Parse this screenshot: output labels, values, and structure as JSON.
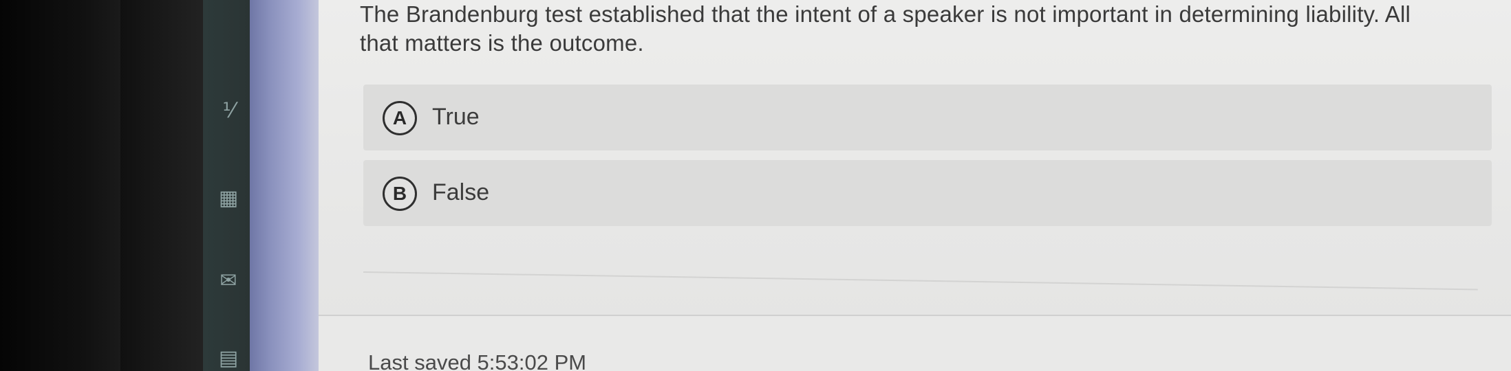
{
  "question": {
    "text": "The Brandenburg test established that the intent of a speaker is not important in determining liability. All that matters is the outcome."
  },
  "options": [
    {
      "letter": "A",
      "label": "True"
    },
    {
      "letter": "B",
      "label": "False"
    }
  ],
  "footer": {
    "last_saved": "Last saved 5:53:02 PM"
  },
  "rail": {
    "icons": [
      "calculator-icon",
      "grid-icon",
      "mail-icon",
      "document-icon"
    ]
  }
}
